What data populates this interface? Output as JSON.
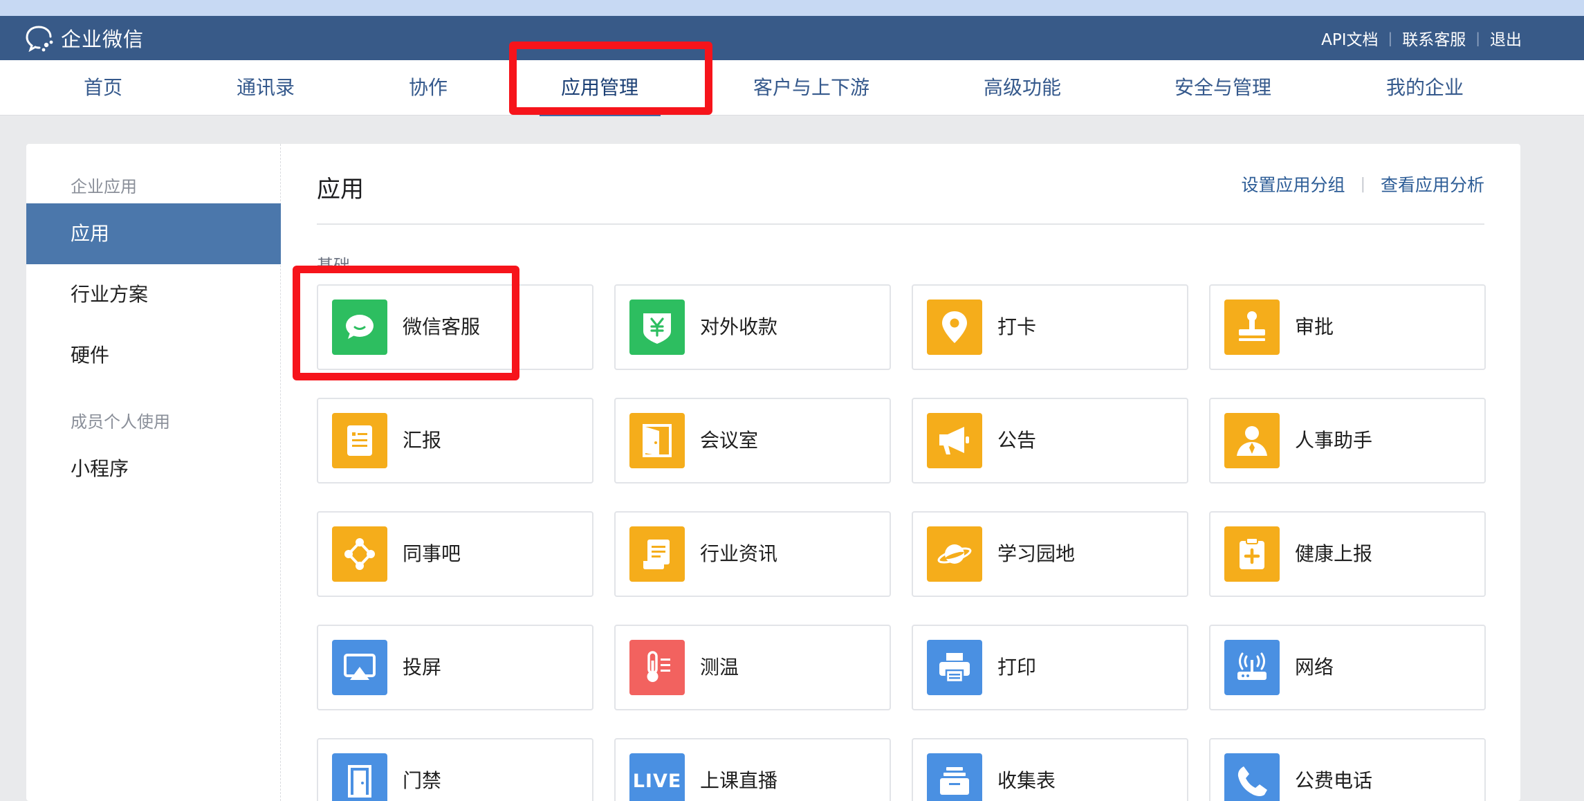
{
  "brand": {
    "name": "企业微信"
  },
  "top_links": [
    {
      "label": "API文档"
    },
    {
      "label": "联系客服"
    },
    {
      "label": "退出"
    }
  ],
  "nav": [
    {
      "label": "首页"
    },
    {
      "label": "通讯录"
    },
    {
      "label": "协作"
    },
    {
      "label": "应用管理",
      "active": true
    },
    {
      "label": "客户与上下游"
    },
    {
      "label": "高级功能"
    },
    {
      "label": "安全与管理"
    },
    {
      "label": "我的企业"
    }
  ],
  "sidebar": {
    "group_enterprise": "企业应用",
    "items_enterprise": [
      {
        "label": "应用",
        "active": true
      },
      {
        "label": "行业方案"
      },
      {
        "label": "硬件"
      }
    ],
    "group_personal": "成员个人使用",
    "items_personal": [
      {
        "label": "小程序"
      }
    ]
  },
  "content": {
    "title": "应用",
    "link_group": "设置应用分组",
    "link_analysis": "查看应用分析",
    "section": "基础"
  },
  "apps": [
    {
      "name": "微信客服",
      "icon": "chat-bubble-icon",
      "color": "#2dbe60"
    },
    {
      "name": "对外收款",
      "icon": "yuan-shield-icon",
      "color": "#2dbe60"
    },
    {
      "name": "打卡",
      "icon": "location-pin-icon",
      "color": "#f5ad1b"
    },
    {
      "name": "审批",
      "icon": "stamp-icon",
      "color": "#f5ad1b"
    },
    {
      "name": "汇报",
      "icon": "report-icon",
      "color": "#f5ad1b"
    },
    {
      "name": "会议室",
      "icon": "door-icon",
      "color": "#f5ad1b"
    },
    {
      "name": "公告",
      "icon": "megaphone-icon",
      "color": "#f5ad1b"
    },
    {
      "name": "人事助手",
      "icon": "person-icon",
      "color": "#f5ad1b"
    },
    {
      "name": "同事吧",
      "icon": "network-icon",
      "color": "#f5ad1b"
    },
    {
      "name": "行业资讯",
      "icon": "scroll-icon",
      "color": "#f5ad1b"
    },
    {
      "name": "学习园地",
      "icon": "planet-icon",
      "color": "#f5ad1b"
    },
    {
      "name": "健康上报",
      "icon": "health-clipboard-icon",
      "color": "#f5ad1b"
    },
    {
      "name": "投屏",
      "icon": "screen-cast-icon",
      "color": "#4a90e2"
    },
    {
      "name": "测温",
      "icon": "thermometer-icon",
      "color": "#f2625f"
    },
    {
      "name": "打印",
      "icon": "printer-icon",
      "color": "#4a90e2"
    },
    {
      "name": "网络",
      "icon": "router-icon",
      "color": "#4a90e2"
    },
    {
      "name": "门禁",
      "icon": "door-access-icon",
      "color": "#4a90e2"
    },
    {
      "name": "上课直播",
      "icon": "live-icon",
      "icon_text": "LIVE",
      "color": "#4a90e2"
    },
    {
      "name": "收集表",
      "icon": "collection-box-icon",
      "color": "#4a90e2"
    },
    {
      "name": "公费电话",
      "icon": "phone-icon",
      "color": "#4a90e2"
    }
  ],
  "colors": {
    "topbar": "#385a88",
    "nav_text": "#35598c",
    "sidebar_active": "#4b77ab",
    "highlight": "#f6141b"
  }
}
